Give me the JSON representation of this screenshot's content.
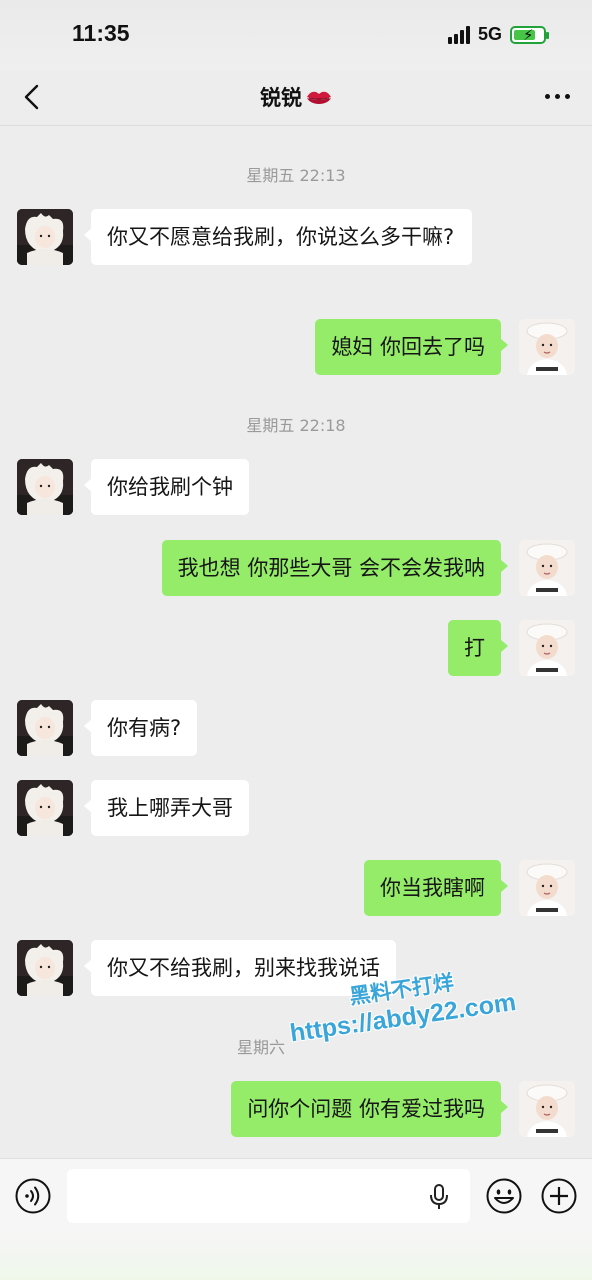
{
  "status": {
    "time": "11:35",
    "network": "5G",
    "battery_level": 0.75
  },
  "nav": {
    "title": "锐锐",
    "title_emoji_icon": "lips-icon",
    "more_icon": "more-dots-icon",
    "back_icon": "back-chevron-icon"
  },
  "chat": {
    "time_labels": [
      "星期五 22:13",
      "星期五 22:18",
      "星期六"
    ],
    "messages": [
      {
        "side": "left",
        "text": "你又不愿意给我刷，你说这么多干嘛?"
      },
      {
        "side": "right",
        "text": "媳妇 你回去了吗"
      },
      {
        "side": "left",
        "text": "你给我刷个钟"
      },
      {
        "side": "right",
        "text": "我也想 你那些大哥 会不会发我呐"
      },
      {
        "side": "right",
        "text": "打"
      },
      {
        "side": "left",
        "text": "你有病?"
      },
      {
        "side": "left",
        "text": "我上哪弄大哥"
      },
      {
        "side": "right",
        "text": "你当我瞎啊"
      },
      {
        "side": "left",
        "text": "你又不给我刷，别来找我说话"
      },
      {
        "side": "right",
        "text": "问你个问题 你有爱过我吗"
      }
    ]
  },
  "watermark": {
    "line1": "黑料不打烊",
    "line2": "https://abdy22.com"
  },
  "input": {
    "value": "",
    "voice_icon": "voice-icon",
    "mic_icon": "mic-icon",
    "emoji_icon": "emoji-icon",
    "plus_icon": "plus-icon"
  },
  "colors": {
    "bubble_self": "#95ec69",
    "bubble_other": "#ffffff",
    "background": "#ededed",
    "watermark": "#3aa5d8"
  }
}
